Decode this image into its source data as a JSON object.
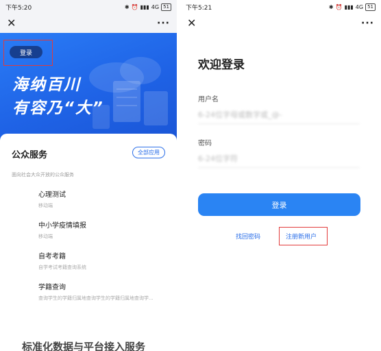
{
  "left": {
    "status": {
      "time": "下午5:20",
      "signal": "4G",
      "battery": "51"
    },
    "nav": {
      "close_icon": "close-icon",
      "more_icon": "more-icon"
    },
    "banner": {
      "login_label": "登录",
      "slogan_line1": "海纳百川",
      "slogan_line2": "有容乃“大”"
    },
    "services": {
      "title": "公众服务",
      "all_apps": "全部应用",
      "subtitle": "面向社会大众开放的公众服务",
      "items": [
        {
          "name": "心理测试",
          "desc": "移动端"
        },
        {
          "name": "中小学疫情填报",
          "desc": "移动端"
        },
        {
          "name": "自考考籍",
          "desc": "自学考试考籍查询系统"
        },
        {
          "name": "学籍查询",
          "desc": "查询学生的学籍归属地查询学生的学籍归属地查询学..."
        }
      ]
    },
    "bottom_heading": "标准化数据与平台接入服务"
  },
  "right": {
    "status": {
      "time": "下午5:21",
      "signal": "4G",
      "battery": "51"
    },
    "nav": {
      "close_icon": "close-icon",
      "more_icon": "more-icon"
    },
    "welcome": "欢迎登录",
    "username_label": "用户名",
    "username_value": "6-24位字母或数字或_@-",
    "password_label": "密码",
    "password_value": "6-24位字符",
    "login_button": "登录",
    "forgot_password": "找回密码",
    "register": "注册新用户"
  },
  "colors": {
    "primary_blue": "#2a84f3",
    "banner_blue": "#2a7cf6",
    "highlight_red": "#e23b3b"
  }
}
